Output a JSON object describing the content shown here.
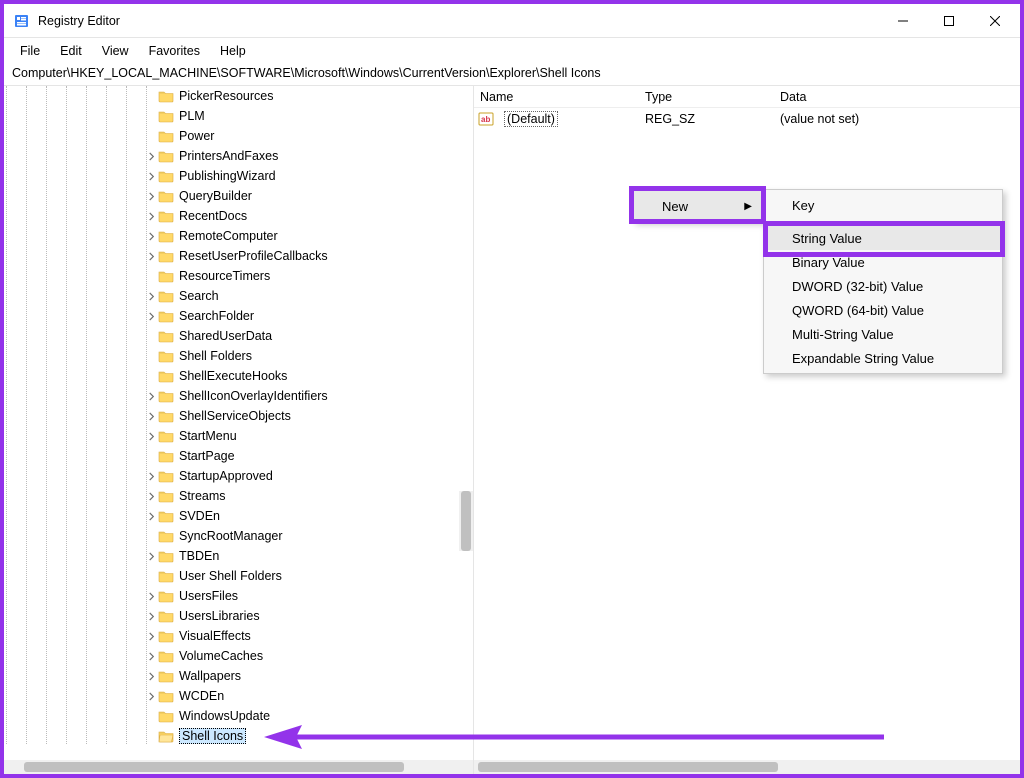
{
  "titlebar": {
    "title": "Registry Editor"
  },
  "menubar": {
    "items": [
      "File",
      "Edit",
      "View",
      "Favorites",
      "Help"
    ]
  },
  "address": "Computer\\HKEY_LOCAL_MACHINE\\SOFTWARE\\Microsoft\\Windows\\CurrentVersion\\Explorer\\Shell Icons",
  "tree": {
    "nodes": [
      {
        "label": "PickerResources",
        "expandable": false
      },
      {
        "label": "PLM",
        "expandable": false
      },
      {
        "label": "Power",
        "expandable": false
      },
      {
        "label": "PrintersAndFaxes",
        "expandable": true
      },
      {
        "label": "PublishingWizard",
        "expandable": true
      },
      {
        "label": "QueryBuilder",
        "expandable": true
      },
      {
        "label": "RecentDocs",
        "expandable": true
      },
      {
        "label": "RemoteComputer",
        "expandable": true
      },
      {
        "label": "ResetUserProfileCallbacks",
        "expandable": true
      },
      {
        "label": "ResourceTimers",
        "expandable": false
      },
      {
        "label": "Search",
        "expandable": true
      },
      {
        "label": "SearchFolder",
        "expandable": true
      },
      {
        "label": "SharedUserData",
        "expandable": false
      },
      {
        "label": "Shell Folders",
        "expandable": false
      },
      {
        "label": "ShellExecuteHooks",
        "expandable": false
      },
      {
        "label": "ShellIconOverlayIdentifiers",
        "expandable": true
      },
      {
        "label": "ShellServiceObjects",
        "expandable": true
      },
      {
        "label": "StartMenu",
        "expandable": true
      },
      {
        "label": "StartPage",
        "expandable": false
      },
      {
        "label": "StartupApproved",
        "expandable": true
      },
      {
        "label": "Streams",
        "expandable": true
      },
      {
        "label": "SVDEn",
        "expandable": true
      },
      {
        "label": "SyncRootManager",
        "expandable": false
      },
      {
        "label": "TBDEn",
        "expandable": true
      },
      {
        "label": "User Shell Folders",
        "expandable": false
      },
      {
        "label": "UsersFiles",
        "expandable": true
      },
      {
        "label": "UsersLibraries",
        "expandable": true
      },
      {
        "label": "VisualEffects",
        "expandable": true
      },
      {
        "label": "VolumeCaches",
        "expandable": true
      },
      {
        "label": "Wallpapers",
        "expandable": true
      },
      {
        "label": "WCDEn",
        "expandable": true
      },
      {
        "label": "WindowsUpdate",
        "expandable": false
      },
      {
        "label": "Shell Icons",
        "expandable": false,
        "selected": true
      }
    ]
  },
  "list": {
    "headers": {
      "name": "Name",
      "type": "Type",
      "data": "Data"
    },
    "rows": [
      {
        "name": "(Default)",
        "type": "REG_SZ",
        "data": "(value not set)"
      }
    ]
  },
  "context_menu": {
    "primary": [
      {
        "label": "New",
        "has_submenu": true,
        "hover": true
      }
    ],
    "submenu": [
      {
        "label": "Key"
      },
      {
        "sep": true
      },
      {
        "label": "String Value",
        "hover": true
      },
      {
        "label": "Binary Value"
      },
      {
        "label": "DWORD (32-bit) Value"
      },
      {
        "label": "QWORD (64-bit) Value"
      },
      {
        "label": "Multi-String Value"
      },
      {
        "label": "Expandable String Value"
      }
    ]
  },
  "colors": {
    "highlight": "#9333ea"
  }
}
